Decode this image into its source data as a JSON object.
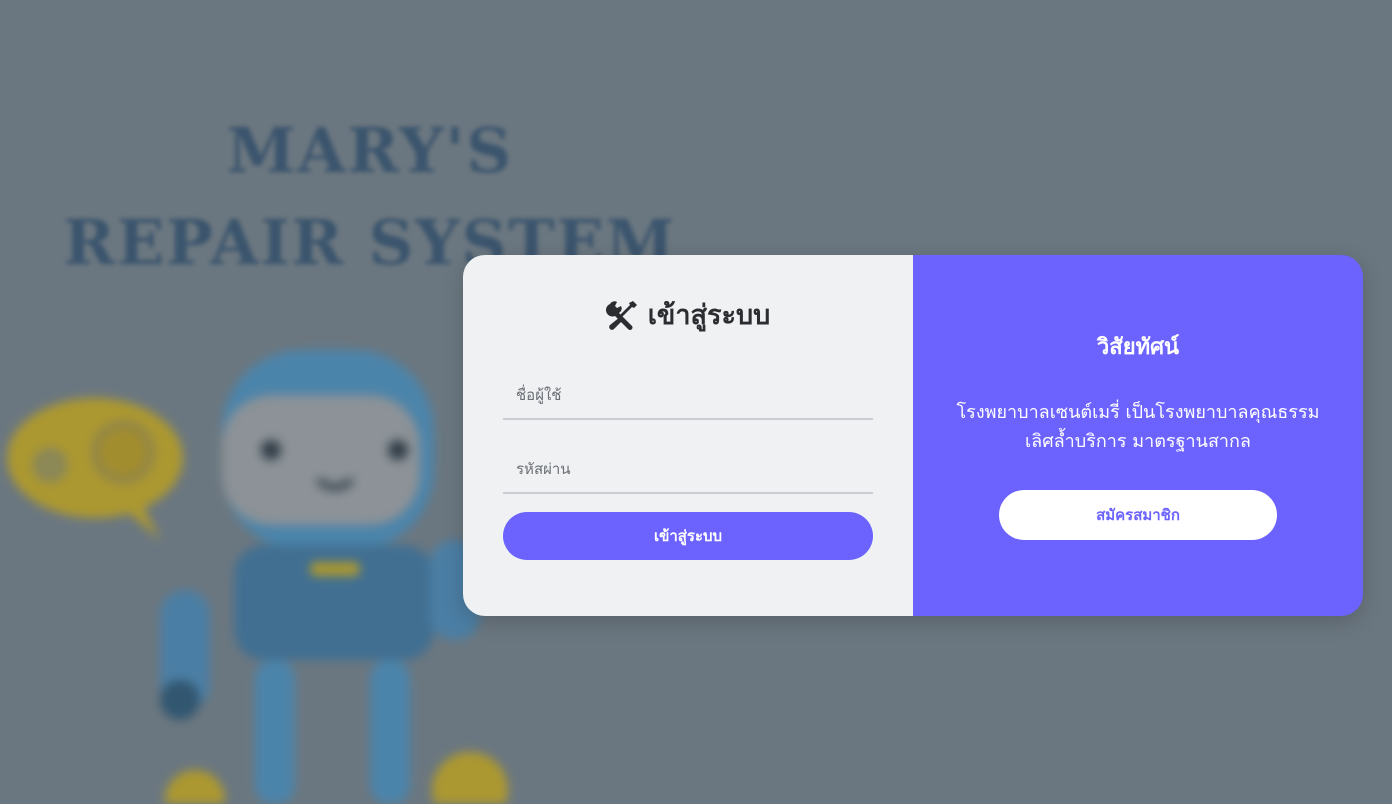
{
  "background": {
    "title_line1": "MARY'S",
    "title_line2": "REPAIR SYSTEM"
  },
  "login": {
    "title": "เข้าสู่ระบบ",
    "title_icon": "tools-icon",
    "username_placeholder": "ชื่อผู้ใช้",
    "password_placeholder": "รหัสผ่าน",
    "submit_label": "เข้าสู่ระบบ"
  },
  "side": {
    "heading": "วิสัยทัศน์",
    "line1": "โรงพยาบาลเซนต์เมรี่ เป็นโรงพยาบาลคุณธรรม",
    "line2": "เลิศล้ำบริการ มาตรฐานสากล",
    "register_label": "สมัครสมาชิก"
  },
  "colors": {
    "accent": "#6c63ff",
    "overlay": "#6b7780",
    "panel": "#eff1f3"
  }
}
